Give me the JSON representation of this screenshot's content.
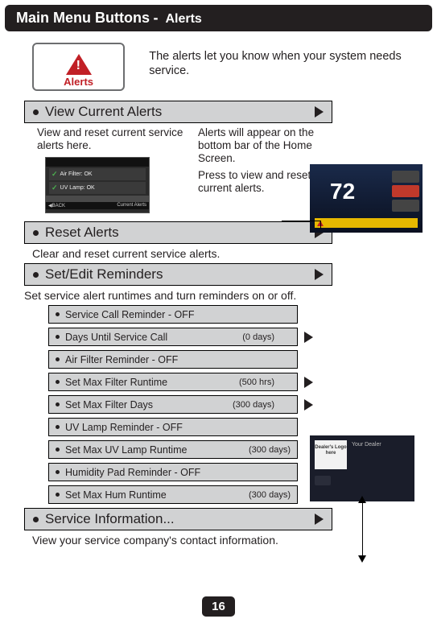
{
  "header": {
    "title": "Main Menu Buttons",
    "separator": " - ",
    "crumb": "Alerts"
  },
  "alerts_card": {
    "icon_label": "!",
    "label": "Alerts"
  },
  "intro": "The alerts let you know when your system needs service.",
  "view_current": {
    "label": "View Current Alerts",
    "left_caption": "View and reset current service alerts here.",
    "mid_caption1": "Alerts will appear on the bottom bar of the Home Screen.",
    "mid_caption2": "Press to view and reset current alerts."
  },
  "reset_alerts": {
    "label": "Reset Alerts",
    "caption": "Clear and reset current service alerts."
  },
  "set_edit": {
    "label": "Set/Edit Reminders",
    "caption": "Set service alert runtimes and turn reminders on or off.",
    "items": [
      {
        "label": "Service Call Reminder - OFF",
        "value": ""
      },
      {
        "label": "Days Until Service Call",
        "value": "(0 days)",
        "arrow": true
      },
      {
        "label": "Air Filter Reminder - OFF",
        "value": ""
      },
      {
        "label": "Set Max Filter Runtime",
        "value": "(500 hrs)",
        "arrow": true
      },
      {
        "label": "Set Max Filter Days",
        "value": "(300 days)",
        "arrow": true
      },
      {
        "label": "UV Lamp Reminder - OFF",
        "value": ""
      },
      {
        "label": "Set Max UV Lamp Runtime",
        "value": "(300 days)",
        "close": true
      },
      {
        "label": "Humidity Pad Reminder - OFF",
        "value": ""
      },
      {
        "label": "Set Max Hum Runtime",
        "value": "(300 days)",
        "close": true
      }
    ]
  },
  "service_info": {
    "label": "Service Information...",
    "caption": "View your service company's contact information."
  },
  "thumb1": {
    "line1": "Air Filter: OK",
    "line2": "UV Lamp: OK",
    "back": "◀BACK",
    "title": "Current Alerts"
  },
  "thumb2": {
    "temp": "72"
  },
  "thumb3": {
    "logo": "Dealer's Logo here",
    "hdr": "Your Dealer"
  },
  "page": "16"
}
